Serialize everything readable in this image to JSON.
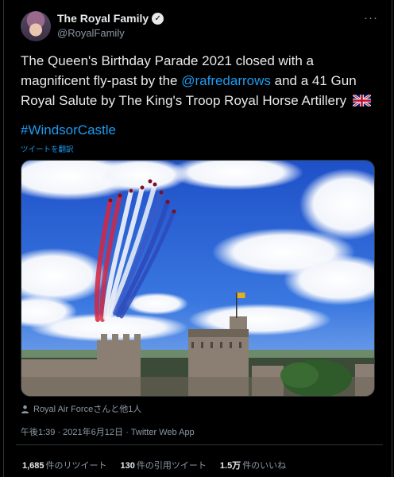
{
  "account": {
    "display_name": "The Royal Family",
    "handle": "@RoyalFamily",
    "verified_glyph": "✓",
    "more_glyph": "···"
  },
  "tweet": {
    "text_part1": "The Queen's Birthday Parade 2021 closed with a magnificent fly-past by the ",
    "mention": "@rafredarrows",
    "text_part2": " and a 41 Gun Royal Salute by The King's Troop Royal Horse Artillery ",
    "flag_icon": "union-jack-flag-icon",
    "hashtag": "#WindsorCastle",
    "translate_label": "ツイートを翻訳"
  },
  "photo": {
    "subject": "red-arrows-flypast-over-windsor-castle"
  },
  "likers": {
    "icon": "person-icon",
    "text": "Royal Air Forceさんと他1人"
  },
  "meta": {
    "text": "午後1:39 · 2021年6月12日 · Twitter Web App"
  },
  "stats": {
    "retweets_count": "1,685",
    "retweets_label": "件のリツイート",
    "quotes_count": "130",
    "quotes_label": "件の引用ツイート",
    "likes_count": "1.5万",
    "likes_label": "件のいいね"
  },
  "colors": {
    "background": "#000000",
    "text": "#e7e9ea",
    "secondary": "#8b98a5",
    "link": "#1d9bf0",
    "border": "#2f3336"
  }
}
